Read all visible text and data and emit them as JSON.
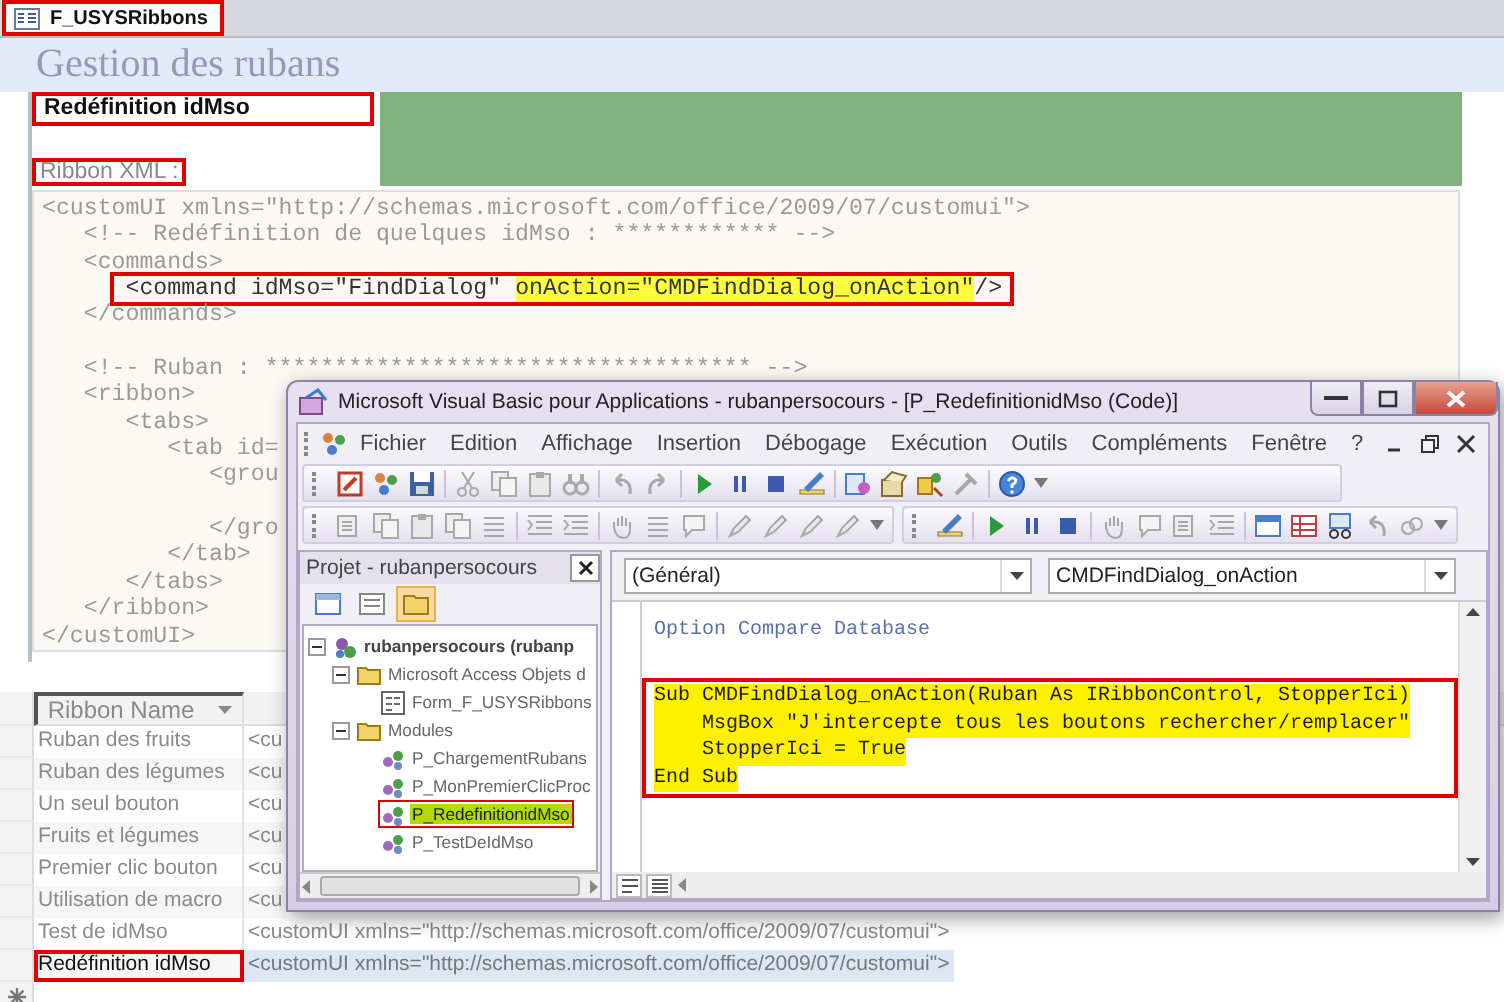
{
  "document_tab": {
    "label": "F_USYSRibbons",
    "selected": true,
    "marked": true
  },
  "form": {
    "title": "Gestion des rubans",
    "ribbon_name": {
      "value": "Redéfinition idMso",
      "marked": true
    },
    "xml_label": {
      "text": "Ribbon XML :",
      "marked": true
    },
    "xml_lines": [
      {
        "kind": "code",
        "text": "<customUI xmlns=\"http://schemas.microsoft.com/office/2009/07/customui\">",
        "marked": false
      },
      {
        "kind": "code",
        "text": "   <!-- Redéfinition de quelques idMso : ************ -->",
        "marked": false
      },
      {
        "kind": "code",
        "text": "   <commands>",
        "marked": false
      },
      {
        "kind": "code",
        "text": "      <command idMso=\"FindDialog\" ",
        "highlight": "onAction=\"CMDFindDialog_onAction\"",
        "after": "/>",
        "marked": true
      },
      {
        "kind": "code",
        "text": "   </commands>",
        "marked": false
      },
      {
        "kind": "blank"
      },
      {
        "kind": "code",
        "text": "   <!-- Ruban : *********************************** -->",
        "marked": false
      },
      {
        "kind": "code",
        "text": "   <ribbon>",
        "marked": false
      },
      {
        "kind": "code",
        "text": "      <tabs>",
        "marked": false
      },
      {
        "kind": "code",
        "text": "         <tab id=",
        "marked": false
      },
      {
        "kind": "code",
        "text": "            <grou",
        "marked": false
      },
      {
        "kind": "blank"
      },
      {
        "kind": "code",
        "text": "            </gro",
        "marked": false
      },
      {
        "kind": "code",
        "text": "         </tab>",
        "marked": false
      },
      {
        "kind": "code",
        "text": "      </tabs>",
        "marked": false
      },
      {
        "kind": "code",
        "text": "   </ribbon>",
        "marked": false
      },
      {
        "kind": "code",
        "text": "</customUI>",
        "marked": false
      }
    ]
  },
  "table": {
    "columns": [
      {
        "label": "Ribbon Name"
      }
    ],
    "rows": [
      {
        "cells": [
          "Ruban des fruits",
          "<cu"
        ],
        "selected": false,
        "marked": false
      },
      {
        "cells": [
          "Ruban des légumes",
          "<cu"
        ],
        "selected": false,
        "marked": false
      },
      {
        "cells": [
          "Un seul bouton",
          "<cu"
        ],
        "selected": false,
        "marked": false
      },
      {
        "cells": [
          "Fruits et légumes",
          "<cu"
        ],
        "selected": false,
        "marked": false
      },
      {
        "cells": [
          "Premier clic bouton",
          "<cu"
        ],
        "selected": false,
        "marked": false
      },
      {
        "cells": [
          "Utilisation de macro",
          "<cu"
        ],
        "selected": false,
        "marked": false
      },
      {
        "cells": [
          "Test de idMso",
          "<customUI xmlns=\"http://schemas.microsoft.com/office/2009/07/customui\">"
        ],
        "selected": false,
        "marked": false
      },
      {
        "cells": [
          "Redéfinition idMso",
          "<customUI xmlns=\"http://schemas.microsoft.com/office/2009/07/customui\">"
        ],
        "selected": true,
        "marked": true
      }
    ]
  },
  "vba_window": {
    "title": "Microsoft Visual Basic pour Applications - rubanpersocours - [P_RedefinitionidMso (Code)]",
    "menu": [
      {
        "label": "Fichier"
      },
      {
        "label": "Edition"
      },
      {
        "label": "Affichage"
      },
      {
        "label": "Insertion"
      },
      {
        "label": "Débogage"
      },
      {
        "label": "Exécution"
      },
      {
        "label": "Outils"
      },
      {
        "label": "Compléments"
      },
      {
        "label": "Fenêtre"
      },
      {
        "label": "?"
      }
    ],
    "project_pane": {
      "title": "Projet - rubanpersocours",
      "tree": [
        {
          "label": "rubanpersocours (rubanp",
          "kind": "project",
          "expanded": true,
          "selected": false,
          "marked": false,
          "children": [
            {
              "label": "Microsoft Access Objets d",
              "kind": "folder",
              "expanded": true,
              "selected": false,
              "marked": false,
              "children": [
                {
                  "label": "Form_F_USYSRibbons",
                  "kind": "form",
                  "selected": false,
                  "marked": false
                }
              ]
            },
            {
              "label": "Modules",
              "kind": "folder",
              "expanded": true,
              "selected": false,
              "marked": false,
              "children": [
                {
                  "label": "P_ChargementRubans",
                  "kind": "module",
                  "selected": false,
                  "marked": false
                },
                {
                  "label": "P_MonPremierClicProc",
                  "kind": "module",
                  "selected": false,
                  "marked": false
                },
                {
                  "label": "P_RedefinitionidMso",
                  "kind": "module",
                  "selected": true,
                  "marked": true
                },
                {
                  "label": "P_TestDeIdMso",
                  "kind": "module",
                  "selected": false,
                  "marked": false
                }
              ]
            }
          ]
        }
      ]
    },
    "code_pane": {
      "object_dropdown": "(Général)",
      "procedure_dropdown": "CMDFindDialog_onAction",
      "blocks": [
        {
          "marked": false,
          "lines": [
            {
              "kind": "code",
              "text": "Option Compare Database",
              "highlighted": false
            },
            {
              "kind": "blank"
            }
          ]
        },
        {
          "marked": true,
          "lines": [
            {
              "kind": "code",
              "text": "Sub CMDFindDialog_onAction(Ruban As IRibbonControl, StopperIci)",
              "highlighted": true
            },
            {
              "kind": "code",
              "text": "    MsgBox \"J'intercepte tous les boutons rechercher/remplacer\"",
              "highlighted": true
            },
            {
              "kind": "code",
              "text": "    StopperIci = True",
              "highlighted": true
            },
            {
              "kind": "code",
              "text": "End Sub",
              "highlighted": true
            }
          ]
        }
      ]
    }
  }
}
